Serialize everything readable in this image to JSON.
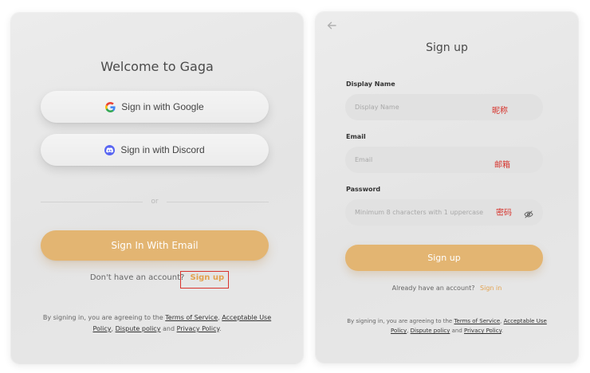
{
  "left": {
    "title": "Welcome to Gaga",
    "google_label": "Sign in with Google",
    "discord_label": "Sign in with Discord",
    "divider_text": "or",
    "email_button_label": "Sign In With Email",
    "no_account_text": "Don't have an account?",
    "signup_link": "Sign up",
    "terms": {
      "prefix": "By signing in, you are agreeing to the",
      "tos": "Terms of Service",
      "comma1": ",",
      "aup": "Acceptable Use Policy",
      "comma2": ",",
      "dispute": "Dispute policy",
      "and": "and",
      "privacy": "Privacy Policy",
      "end": "."
    }
  },
  "right": {
    "title": "Sign up",
    "display_name": {
      "label": "Display Name",
      "placeholder": "Display Name",
      "annotation": "昵称",
      "value": ""
    },
    "email": {
      "label": "Email",
      "placeholder": "Email",
      "annotation": "邮箱",
      "value": ""
    },
    "password": {
      "label": "Password",
      "placeholder": "Minimum 8 characters with 1 uppercase",
      "annotation": "密码",
      "value": ""
    },
    "signup_button_label": "Sign up",
    "already_text": "Already have an account?",
    "signin_link": "Sign in",
    "terms": {
      "prefix": "By signing in, you are agreeing to the",
      "tos": "Terms of Service",
      "comma1": ",",
      "aup": "Acceptable Use Policy",
      "comma2": ",",
      "dispute": "Dispute policy",
      "and": "and",
      "privacy": "Privacy Policy",
      "end": "."
    }
  },
  "colors": {
    "accent": "#e3b572",
    "link": "#e3a24e",
    "annotation": "#d6322b",
    "discord": "#5865f2"
  },
  "icons": {
    "google": "google-icon",
    "discord": "discord-icon",
    "back": "back-arrow-icon",
    "eye": "eye-off-icon"
  }
}
